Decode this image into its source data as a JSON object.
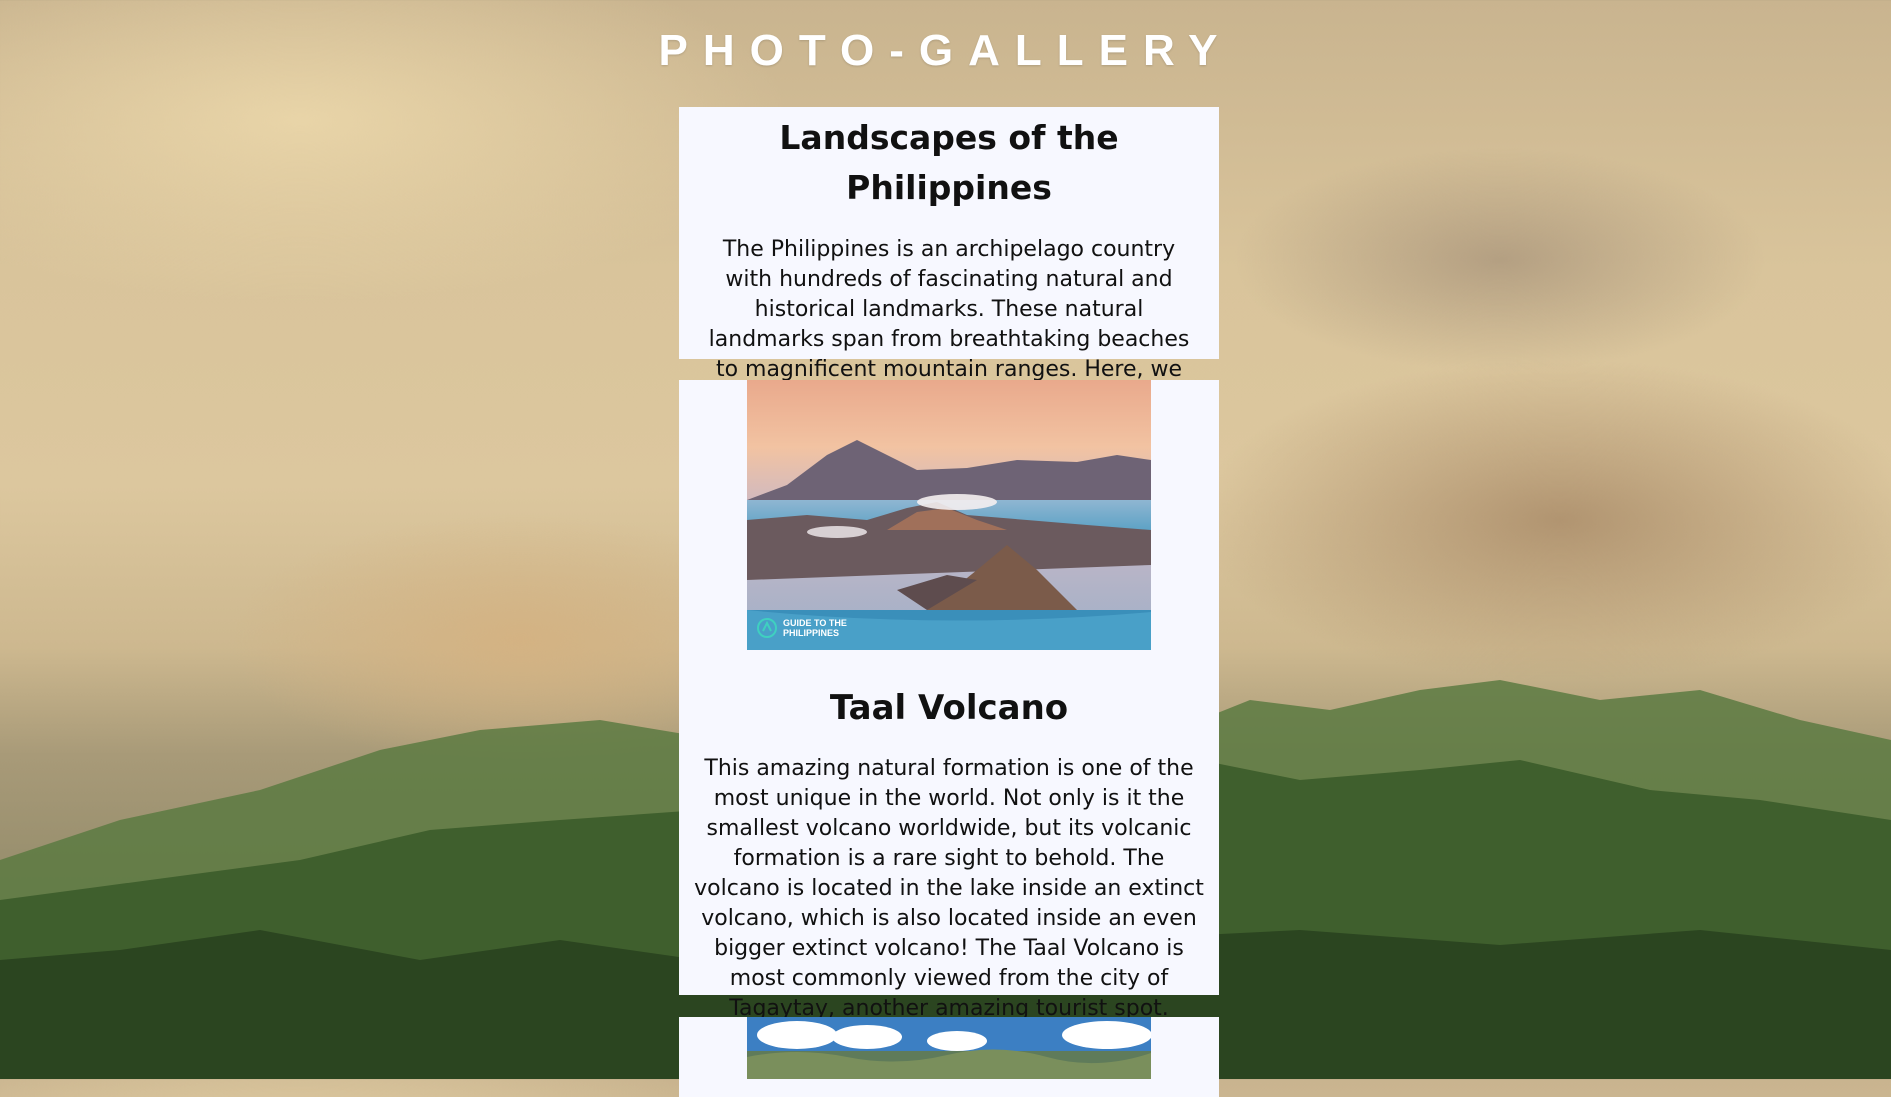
{
  "header": {
    "title": "PHOTO-GALLERY"
  },
  "intro": {
    "heading": "Landscapes of the Philippines",
    "body": "The Philippines is an archipelago country with hundreds of fascinating natural and historical landmarks. These natural landmarks span from breathtaking beaches to magnificent mountain ranges. Here, we showcase some of the best topographical landmarks in the Philippines."
  },
  "gallery": [
    {
      "title": "Taal Volcano",
      "description": "This amazing natural formation is one of the most unique in the world. Not only is it the smallest volcano worldwide, but its volcanic formation is a rare sight to behold. The volcano is located in the lake inside an extinct volcano, which is also located inside an even bigger extinct volcano! The Taal Volcano is most commonly viewed from the city of Tagaytay, another amazing tourist spot.",
      "watermark": {
        "line1": "GUIDE TO THE",
        "line2": "PHILIPPINES"
      }
    }
  ],
  "colors": {
    "card_background": "#f7f8ff",
    "title_color": "#ffffff",
    "text_color": "#111111"
  }
}
